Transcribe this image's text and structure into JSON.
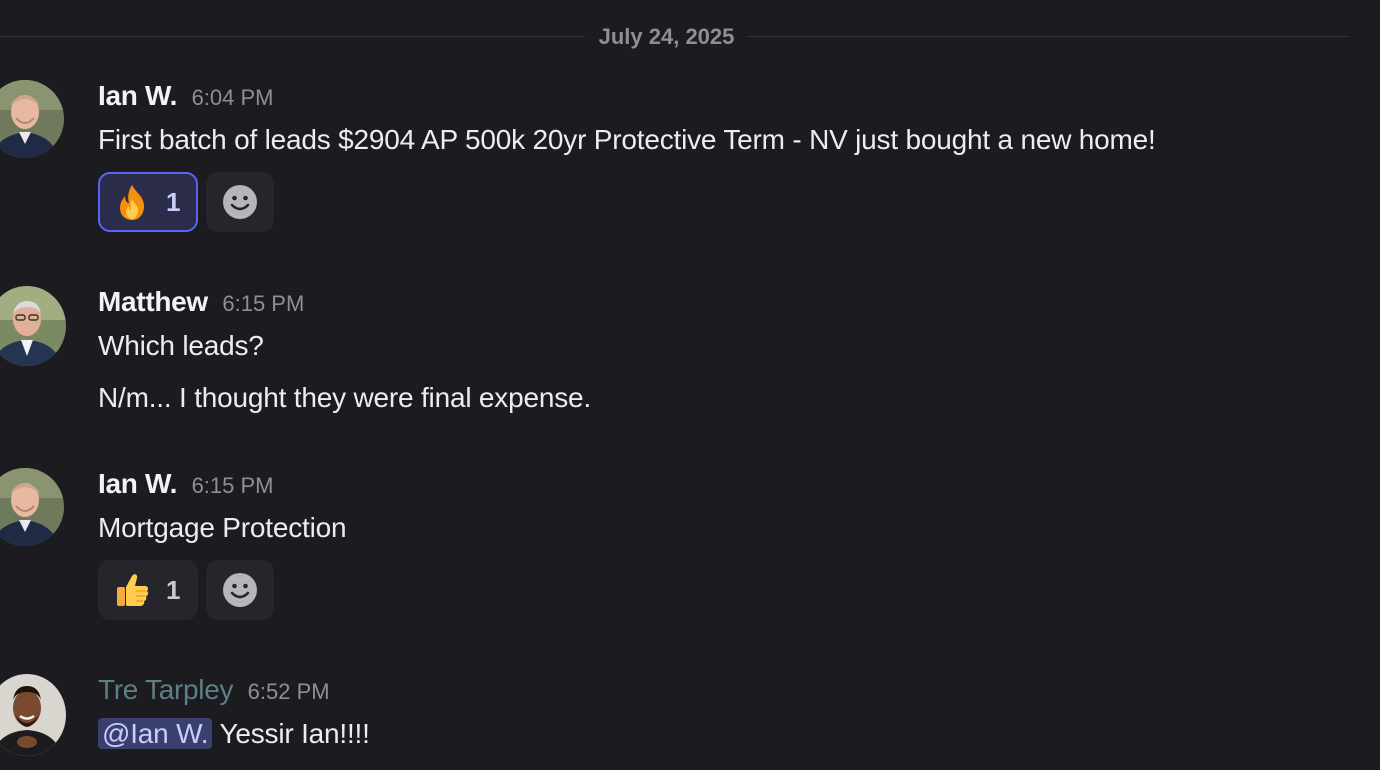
{
  "date_divider": "July 24, 2025",
  "messages": [
    {
      "author": "Ian W.",
      "time": "6:04 PM",
      "lines": [
        "First batch of leads $2904 AP 500k 20yr Protective Term - NV just bought a new home!"
      ],
      "reactions": [
        {
          "emoji": "fire-emoji",
          "count": "1",
          "active": true
        }
      ]
    },
    {
      "author": "Matthew",
      "time": "6:15 PM",
      "lines": [
        "Which leads?",
        "N/m... I thought they were final expense."
      ]
    },
    {
      "author": "Ian W.",
      "time": "6:15 PM",
      "lines": [
        "Mortgage Protection"
      ],
      "reactions": [
        {
          "emoji": "thumbs-up-emoji",
          "count": "1",
          "active": false
        }
      ]
    },
    {
      "author": "Tre Tarpley",
      "author_color": "#5d7f86",
      "time": "6:52 PM",
      "mention": "@Ian W.",
      "text": " Yessir Ian!!!!"
    }
  ],
  "colors": {
    "background": "#1b1b20",
    "reaction_active_border": "#5865f2",
    "mention_background": "#3b3f6e"
  }
}
